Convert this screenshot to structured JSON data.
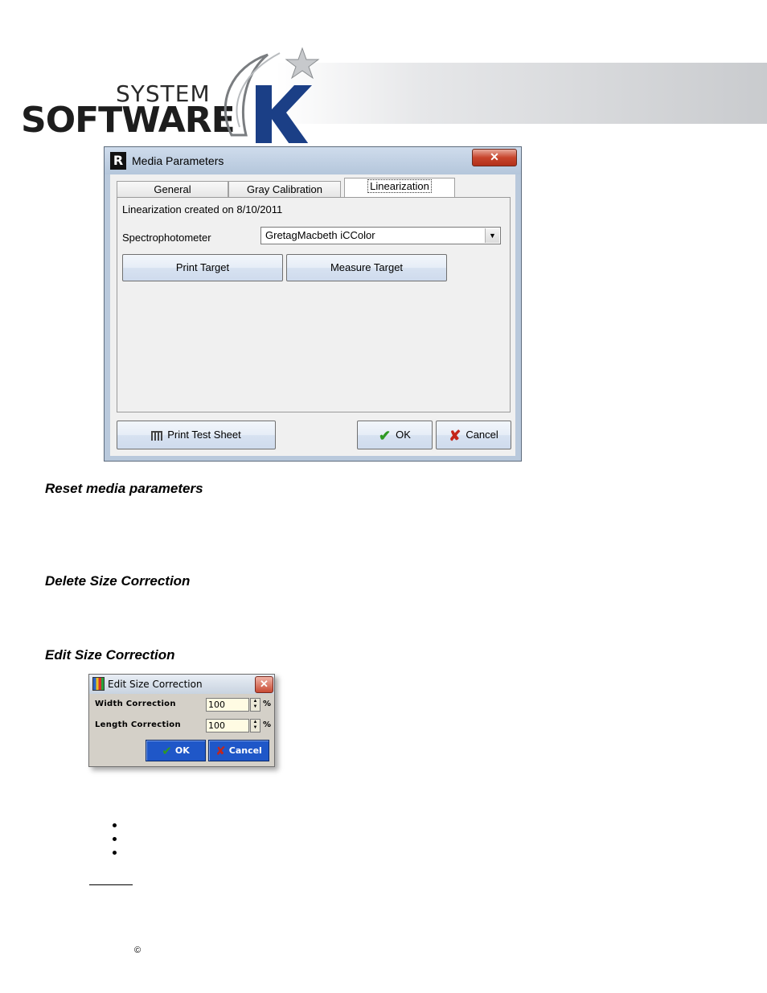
{
  "logo": {
    "line1": "SYSTEM",
    "line2": "SOFTWARE",
    "letter": "K"
  },
  "media_dialog": {
    "title": "Media Parameters",
    "close_glyph": "✕",
    "tabs": [
      {
        "label": "General"
      },
      {
        "label": "Gray Calibration"
      },
      {
        "label": "Linearization",
        "active": true
      }
    ],
    "status": "Linearization created on 8/10/2011",
    "spectrophotometer_label": "Spectrophotometer",
    "spectrophotometer_value": "GretagMacbeth iCColor",
    "print_target": "Print Target",
    "measure_target": "Measure Target",
    "print_test_sheet": "Print Test Sheet",
    "ok": "OK",
    "cancel": "Cancel"
  },
  "headings": {
    "reset": "Reset media parameters",
    "delete": "Delete Size Correction",
    "edit": "Edit Size Correction"
  },
  "edit_dialog": {
    "title": "Edit Size Correction",
    "close_glyph": "✕",
    "width_label": "Width Correction",
    "width_value": "100",
    "length_label": "Length Correction",
    "length_value": "100",
    "unit": "%",
    "ok": "OK",
    "cancel": "Cancel"
  },
  "footer": {
    "copyright": "©"
  }
}
